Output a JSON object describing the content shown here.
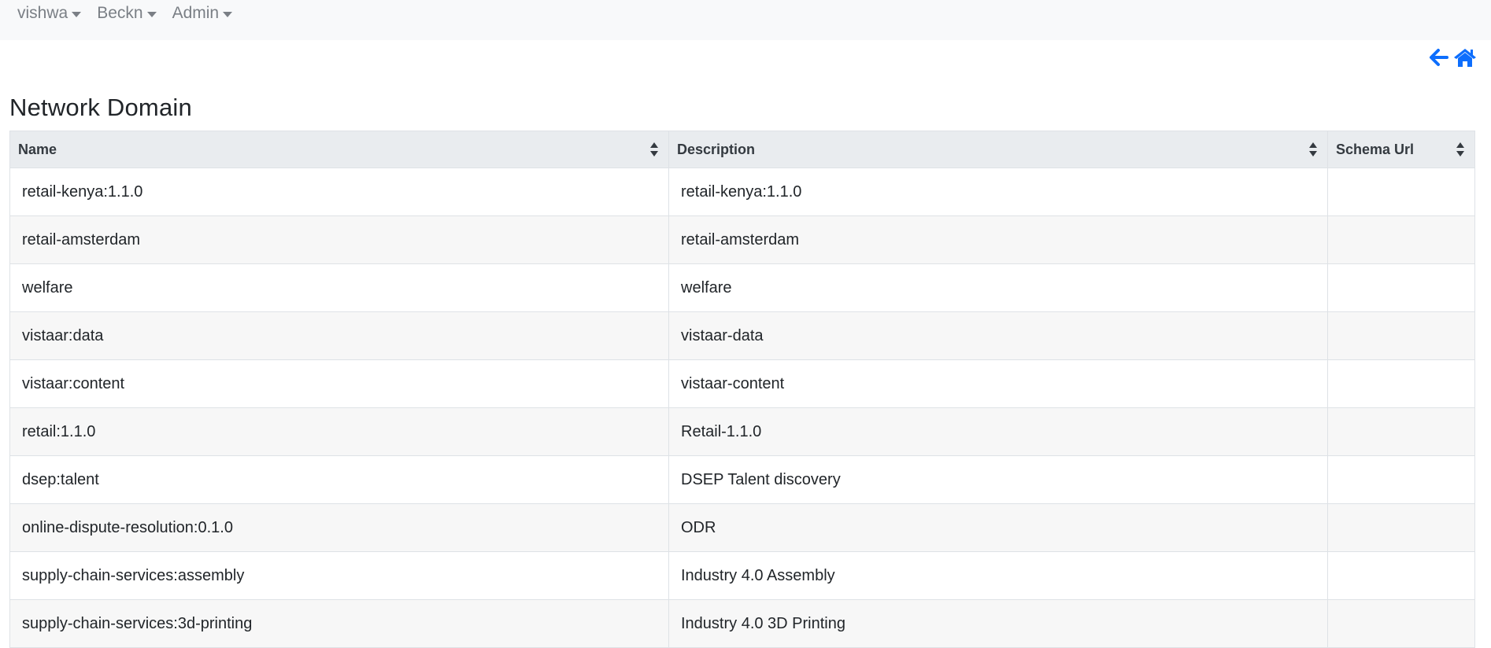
{
  "nav": {
    "items": [
      {
        "label": "vishwa"
      },
      {
        "label": "Beckn"
      },
      {
        "label": "Admin"
      }
    ]
  },
  "actions": {
    "back_icon": "arrow-left-icon",
    "home_icon": "home-icon",
    "accent_color": "#0d6efd"
  },
  "page": {
    "title": "Network Domain"
  },
  "table": {
    "headers": [
      "Name",
      "Description",
      "Schema Url"
    ],
    "rows": [
      [
        "retail-kenya:1.1.0",
        "retail-kenya:1.1.0",
        ""
      ],
      [
        "retail-amsterdam",
        "retail-amsterdam",
        ""
      ],
      [
        "welfare",
        "welfare",
        ""
      ],
      [
        "vistaar:data",
        "vistaar-data",
        ""
      ],
      [
        "vistaar:content",
        "vistaar-content",
        ""
      ],
      [
        "retail:1.1.0",
        "Retail-1.1.0",
        ""
      ],
      [
        "dsep:talent",
        "DSEP Talent discovery",
        ""
      ],
      [
        "online-dispute-resolution:0.1.0",
        "ODR",
        ""
      ],
      [
        "supply-chain-services:assembly",
        "Industry 4.0 Assembly",
        ""
      ],
      [
        "supply-chain-services:3d-printing",
        "Industry 4.0 3D Printing",
        ""
      ]
    ]
  }
}
